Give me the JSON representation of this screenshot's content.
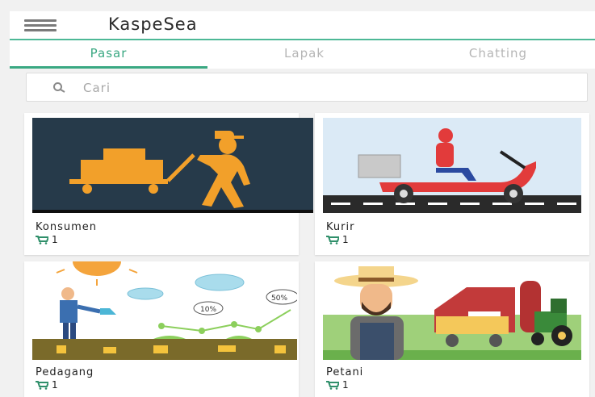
{
  "header": {
    "title": "KaspeSea",
    "menu_icon": "hamburger-menu-icon"
  },
  "tabs": [
    {
      "label": "Pasar",
      "active": true
    },
    {
      "label": "Lapak",
      "active": false
    },
    {
      "label": "Chatting",
      "active": false
    }
  ],
  "search": {
    "placeholder": "Cari",
    "value": ""
  },
  "categories": [
    {
      "title": "Konsumen",
      "count": "1",
      "image": "person-pushing-cart-illustration"
    },
    {
      "title": "Kurir",
      "count": "1",
      "image": "delivery-scooter-illustration"
    },
    {
      "title": "Pedagang",
      "count": "1",
      "image": "merchant-watering-growth-illustration",
      "image_labels": [
        "10%",
        "50%"
      ]
    },
    {
      "title": "Petani",
      "count": "1",
      "image": "farmer-with-barn-and-tractor-illustration"
    }
  ],
  "colors": {
    "accent": "#3aa882",
    "cart_icon": "#2f8f6a"
  }
}
